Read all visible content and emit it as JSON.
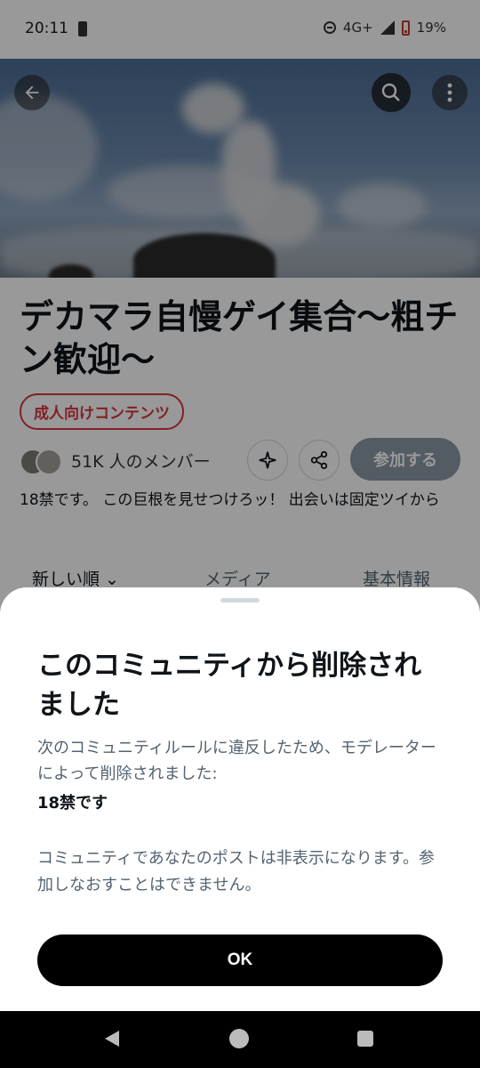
{
  "status_bar": {
    "time": "20:11",
    "network": "4G+",
    "battery": "19%"
  },
  "community": {
    "title": "デカマラ自慢ゲイ集合〜粗チン歓迎〜",
    "nsfw_badge": "成人向けコンテンツ",
    "members": "51K 人のメンバー",
    "join_label": "参加する",
    "description": "18禁です。 この巨根を見せつけろッ！ 出会いは固定ツイから"
  },
  "tabs": [
    {
      "label": "新しい順 ⌄"
    },
    {
      "label": "メディア"
    },
    {
      "label": "基本情報"
    }
  ],
  "sheet": {
    "title": "このコミュニティから削除されました",
    "body": "次のコミュニティルールに違反したため、モデレーターによって削除されました:",
    "rule": "18禁です",
    "body2": "コミュニティであなたのポストは非表示になります。参加しなおすことはできません。",
    "ok_label": "OK"
  },
  "colors": {
    "nsfw_red": "#d9363e",
    "ok_button": "#000000",
    "join_disabled": "#8b98a5"
  }
}
